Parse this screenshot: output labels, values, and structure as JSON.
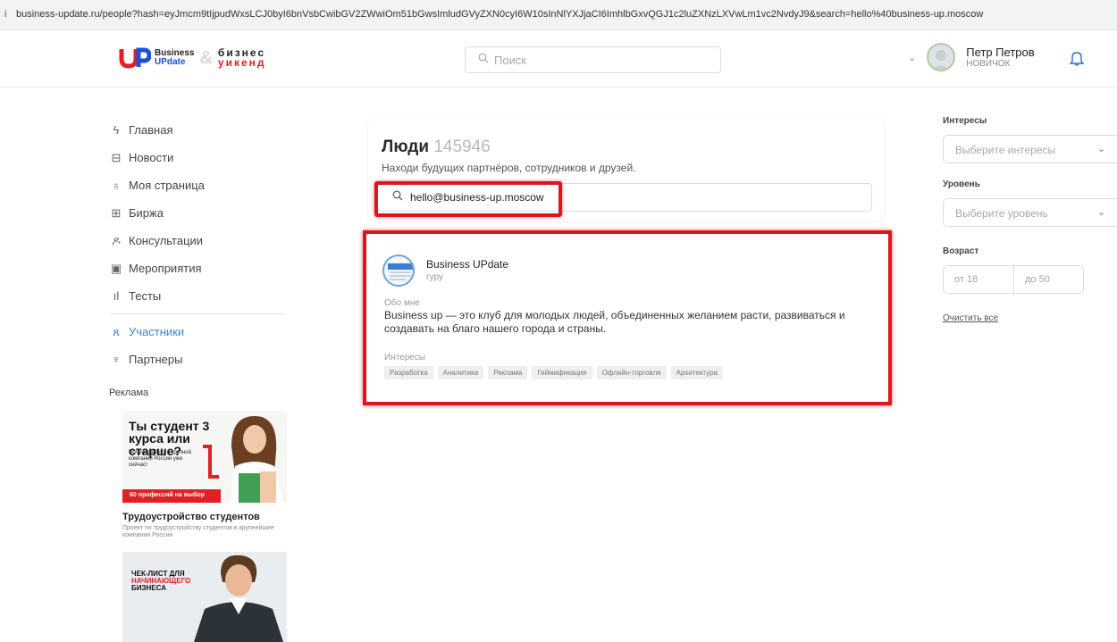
{
  "browser": {
    "url": "business-update.ru/people?hash=eyJmcm9tIjpudWxsLCJ0byI6bnVsbCwibGV2ZWwiOm51bGwsImludGVyZXN0cyI6W10sInNlYXJjaCI6ImhlbGxvQGJ1c2luZXNzLXVwLm1vc2NvdyJ9&search=hello%40business-up.moscow"
  },
  "header": {
    "logo": {
      "line1": "Business",
      "line2": "UPdate",
      "amp": "&",
      "ru1": "бизнес",
      "ru2": "уикенд"
    },
    "search_placeholder": "Поиск",
    "user": {
      "name": "Петр Петров",
      "level": "НОВИЧОК"
    },
    "colors": {
      "brand_red": "#e31e24",
      "brand_blue": "#1d4fd8",
      "accent": "#3b86d6"
    }
  },
  "sidebar": {
    "items": [
      {
        "label": "Главная",
        "icon": "lightning-icon"
      },
      {
        "label": "Новости",
        "icon": "newspaper-icon"
      },
      {
        "label": "Моя страница",
        "icon": "user-icon"
      },
      {
        "label": "Биржа",
        "icon": "exchange-icon"
      },
      {
        "label": "Консультации",
        "icon": "consult-icon"
      },
      {
        "label": "Мероприятия",
        "icon": "calendar-icon"
      },
      {
        "label": "Тесты",
        "icon": "bars-icon"
      },
      {
        "label": "Участники",
        "icon": "users-icon",
        "active": true
      },
      {
        "label": "Партнеры",
        "icon": "award-icon"
      }
    ],
    "ads_title": "Реклама",
    "ad1": {
      "headline": "Ты студент 3 курса или старше?",
      "subtext": "Получи работу в крупной компании России уже сейчас!",
      "band": "60 профессий на выбор",
      "title": "Трудоустройство студентов",
      "description": "Проект по трудоустройству студентов в крупнейшие компании России"
    },
    "ad2": {
      "line1": "ЧЕК-ЛИСТ ДЛЯ",
      "line2": "НАЧИНАЮЩЕГО",
      "line3": "БИЗНЕСА"
    }
  },
  "people": {
    "title": "Люди",
    "count": "145946",
    "subtitle": "Находи будущих партнёров, сотрудников и друзей.",
    "search_value": "hello@business-up.moscow"
  },
  "result": {
    "name": "Business UPdate",
    "level": "гуру",
    "about_label": "Обо мне",
    "about": "Business up — это клуб для молодых людей, объединенных желанием расти, развиваться и создавать на благо нашего города и страны.",
    "interests_label": "Интересы",
    "tags": [
      "Разработка",
      "Аналитика",
      "Реклама",
      "Геймификация",
      "Офлайн-торговля",
      "Архитектура"
    ]
  },
  "filters": {
    "interests_label": "Интересы",
    "interests_placeholder": "Выберите интересы",
    "level_label": "Уровень",
    "level_placeholder": "Выберите уровень",
    "age_label": "Возраст",
    "age_from": "от 18",
    "age_to": "до 50",
    "clear": "Очистить все"
  }
}
